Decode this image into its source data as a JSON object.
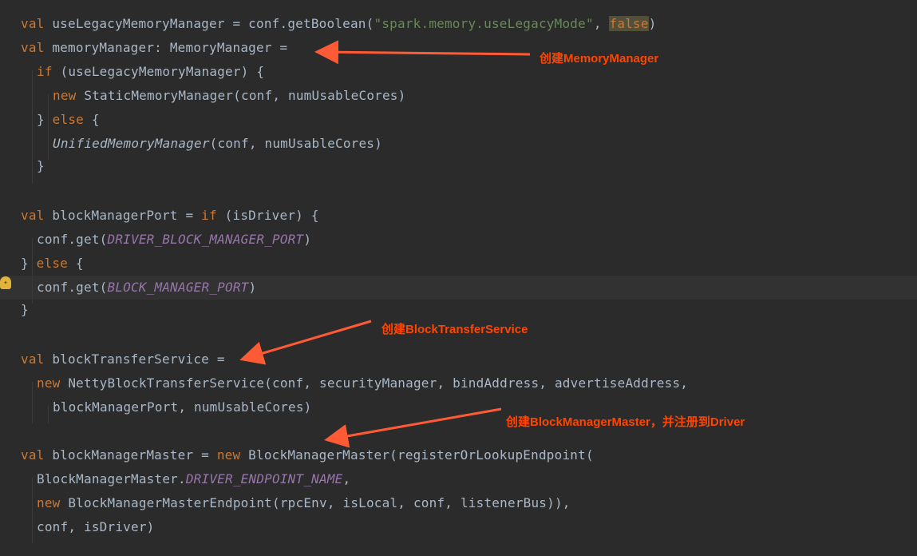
{
  "colors": {
    "background": "#2b2b2b",
    "keyword": "#cc7832",
    "string": "#6a8759",
    "constant": "#9876aa",
    "text": "#a9b7c6",
    "annotation": "#ff4500"
  },
  "icons": {
    "gutter": "lightbulb-icon"
  },
  "lines": [
    [
      {
        "t": "val",
        "c": "kw"
      },
      {
        "t": " useLegacyMemoryManager = conf.getBoolean("
      },
      {
        "t": "\"spark.memory.useLegacyMode\"",
        "c": "str"
      },
      {
        "t": ", "
      },
      {
        "t": "false",
        "c": "kw hl"
      },
      {
        "t": ")"
      }
    ],
    [
      {
        "t": "val",
        "c": "kw"
      },
      {
        "t": " memoryManager: MemoryManager ="
      }
    ],
    [
      {
        "t": "if",
        "c": "kw"
      },
      {
        "t": " (useLegacyMemoryManager) {"
      }
    ],
    [
      {
        "t": "new",
        "c": "kw"
      },
      {
        "t": " StaticMemoryManager(conf, numUsableCores)"
      }
    ],
    [
      {
        "t": "} "
      },
      {
        "t": "else",
        "c": "kw"
      },
      {
        "t": " {"
      }
    ],
    [
      {
        "t": "UnifiedMemoryManager",
        "c": "ital"
      },
      {
        "t": "(conf, numUsableCores)"
      }
    ],
    [
      {
        "t": "}"
      }
    ],
    [],
    [
      {
        "t": "val",
        "c": "kw"
      },
      {
        "t": " blockManagerPort = "
      },
      {
        "t": "if",
        "c": "kw"
      },
      {
        "t": " (isDriver) {"
      }
    ],
    [
      {
        "t": "conf.get("
      },
      {
        "t": "DRIVER_BLOCK_MANAGER_PORT",
        "c": "const"
      },
      {
        "t": ")"
      }
    ],
    [
      {
        "t": "} "
      },
      {
        "t": "else",
        "c": "kw"
      },
      {
        "t": " {"
      }
    ],
    [
      {
        "t": "conf.get("
      },
      {
        "t": "BLOCK_MANAGER_PORT",
        "c": "const"
      },
      {
        "t": ")"
      }
    ],
    [
      {
        "t": "}"
      }
    ],
    [],
    [
      {
        "t": "val",
        "c": "kw"
      },
      {
        "t": " blockTransferService ="
      }
    ],
    [
      {
        "t": "new",
        "c": "kw"
      },
      {
        "t": " NettyBlockTransferService(conf, securityManager, bindAddress, advertiseAddress,"
      }
    ],
    [
      {
        "t": "blockManagerPort, numUsableCores)"
      }
    ],
    [],
    [
      {
        "t": "val",
        "c": "kw"
      },
      {
        "t": " blockManagerMaster = "
      },
      {
        "t": "new",
        "c": "kw"
      },
      {
        "t": " BlockManagerMaster(registerOrLookupEndpoint("
      }
    ],
    [
      {
        "t": "BlockManagerMaster."
      },
      {
        "t": "DRIVER_ENDPOINT_NAME",
        "c": "const"
      },
      {
        "t": ","
      }
    ],
    [
      {
        "t": "new",
        "c": "kw"
      },
      {
        "t": " BlockManagerMasterEndpoint(rpcEnv, isLocal, conf, listenerBus)),"
      }
    ],
    [
      {
        "t": "conf, isDriver)"
      }
    ]
  ],
  "annotations": {
    "memory_manager": "创建MemoryManager",
    "block_transfer_service": "创建BlockTransferService",
    "block_manager_master": "创建BlockManagerMaster，并注册到Driver"
  }
}
